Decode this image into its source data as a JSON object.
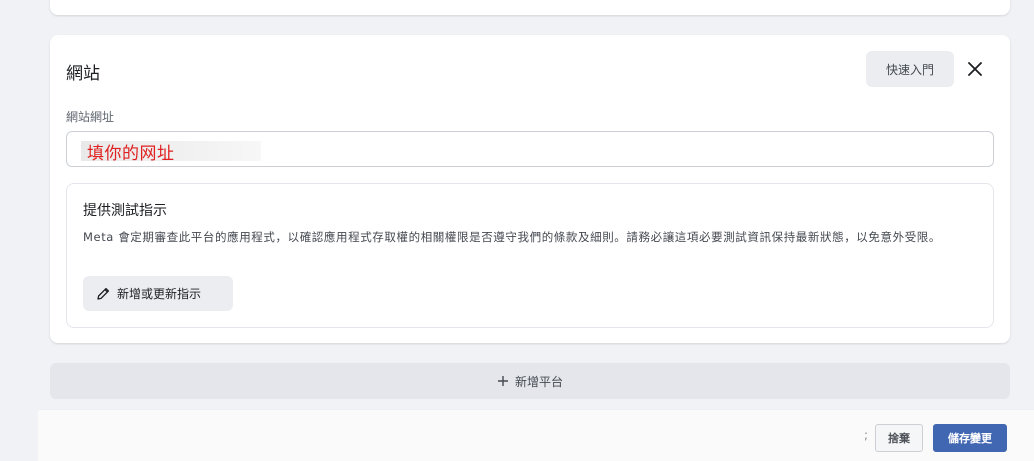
{
  "platform_card": {
    "title": "網站",
    "quickstart_label": "快速入門",
    "field_label": "網站網址",
    "url_value": "填你的网址"
  },
  "test_instructions": {
    "title": "提供測試指示",
    "description": "Meta 會定期審查此平台的應用程式，以確認應用程式存取權的相關權限是否遵守我們的條款及細則。請務必讓這項必要測試資訊保持最新狀態，以免意外受限。",
    "button_label": "新增或更新指示"
  },
  "add_platform": {
    "label": "新增平台"
  },
  "footer": {
    "mark": ";",
    "discard_label": "捨棄",
    "save_label": "儲存變更"
  },
  "icons": {
    "close": "close-icon",
    "pencil": "pencil-icon",
    "plus": "plus-icon"
  },
  "colors": {
    "accent": "#4267b2",
    "url_text": "#e02020"
  }
}
